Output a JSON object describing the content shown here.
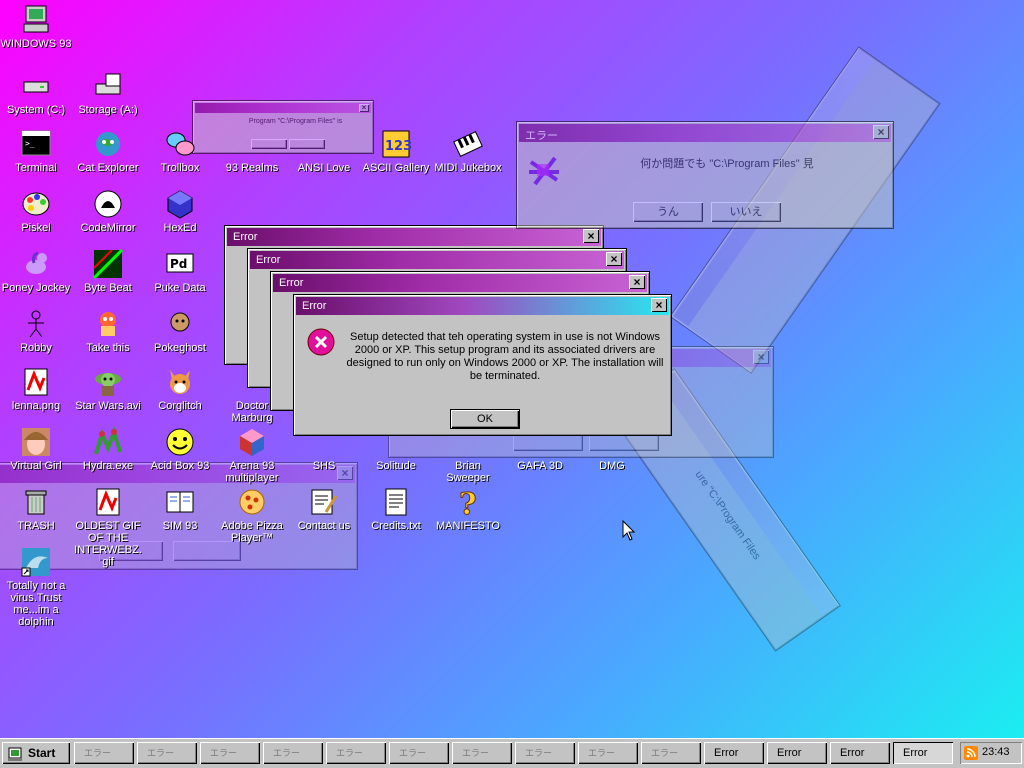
{
  "desktop": {
    "icons": [
      {
        "label": "WINDOWS 93",
        "icon": "computer-icon"
      },
      {
        "label": "System (C:)",
        "icon": "drive-icon"
      },
      {
        "label": "Storage (A:)",
        "icon": "floppy-drive-icon"
      },
      {
        "label": "Terminal",
        "icon": "terminal-icon"
      },
      {
        "label": "Cat Explorer",
        "icon": "cat-globe-icon"
      },
      {
        "label": "Trollbox",
        "icon": "chat-bubbles-icon"
      },
      {
        "label": "93 Realms",
        "icon": "realms-icon"
      },
      {
        "label": "ANSI Love",
        "icon": "ansi-icon"
      },
      {
        "label": "ASCII Gallery",
        "icon": "ascii-123-icon"
      },
      {
        "label": "MIDI Jukebox",
        "icon": "piano-icon"
      },
      {
        "label": "Piskel",
        "icon": "palette-icon"
      },
      {
        "label": "CodeMirror",
        "icon": "codemirror-icon"
      },
      {
        "label": "HexEd",
        "icon": "cube-icon"
      },
      {
        "label": "Poney Jockey",
        "icon": "pony-icon"
      },
      {
        "label": "Byte Beat",
        "icon": "bytebeat-icon"
      },
      {
        "label": "Puke Data",
        "icon": "pd-icon"
      },
      {
        "label": "Robby",
        "icon": "stick-figure-icon"
      },
      {
        "label": "Take this",
        "icon": "creature-icon"
      },
      {
        "label": "Pokeghost",
        "icon": "pokeghost-icon"
      },
      {
        "label": "lenna.png",
        "icon": "image-file-icon"
      },
      {
        "label": "Star Wars.avi",
        "icon": "yoda-icon"
      },
      {
        "label": "Corglitch",
        "icon": "corgi-icon"
      },
      {
        "label": "Doctor Marburg",
        "icon": "doctor-icon"
      },
      {
        "label": "Virtual Girl",
        "icon": "face-icon"
      },
      {
        "label": "Hydra.exe",
        "icon": "hydra-icon"
      },
      {
        "label": "Acid Box 93",
        "icon": "smiley-icon"
      },
      {
        "label": "Arena 93 multiplayer",
        "icon": "arena-cube-icon"
      },
      {
        "label": "SHS",
        "icon": "shs-icon"
      },
      {
        "label": "Solitude",
        "icon": "solitude-icon"
      },
      {
        "label": "Brian Sweeper",
        "icon": "sweeper-icon"
      },
      {
        "label": "GAFA 3D",
        "icon": "gafa-icon"
      },
      {
        "label": "DMG",
        "icon": "dmg-icon"
      },
      {
        "label": "TRASH",
        "icon": "trash-icon"
      },
      {
        "label": "OLDEST GIF OF THE INTERWEBZ.gif",
        "icon": "gif-file-icon"
      },
      {
        "label": "SIM 93",
        "icon": "sim-book-icon"
      },
      {
        "label": "Adobe Pizza Player™",
        "icon": "pizza-icon"
      },
      {
        "label": "Contact us",
        "icon": "contact-icon"
      },
      {
        "label": "Credits.txt",
        "icon": "text-file-icon"
      },
      {
        "label": "MANIFESTO",
        "icon": "question-icon"
      },
      {
        "label": "Totally not a virus.Trust me...im a dolphin",
        "icon": "dolphin-shortcut-icon"
      }
    ]
  },
  "windows": {
    "main_error": {
      "title": "Error",
      "message": "Setup detected that teh operating system in use is not Windows 2000 or XP. This setup program and its associated drivers are designed to run only on Windows 2000 or XP. The installation will be terminated.",
      "ok_label": "OK",
      "icon": "error-x-icon"
    },
    "stacked_errors": [
      {
        "title": "Error"
      },
      {
        "title": "Error"
      },
      {
        "title": "Error"
      }
    ],
    "jp_error": {
      "title": "エラー",
      "message": "何か問題でも \"C:\\Program Files\" 見",
      "yes_label": "うん",
      "no_label": "いいえ"
    },
    "small_ghost": {
      "message": "Program \"C:\\Program Files\" is"
    },
    "faint_dialog": {
      "message": "ure \"C:\\Program Files"
    }
  },
  "taskbar": {
    "start_label": "Start",
    "tasks": [
      "エラー",
      "エラー",
      "エラー",
      "エラー",
      "エラー",
      "エラー",
      "エラー",
      "エラー",
      "エラー",
      "エラー",
      "Error",
      "Error",
      "Error",
      "Error"
    ],
    "clock": "23:43"
  }
}
